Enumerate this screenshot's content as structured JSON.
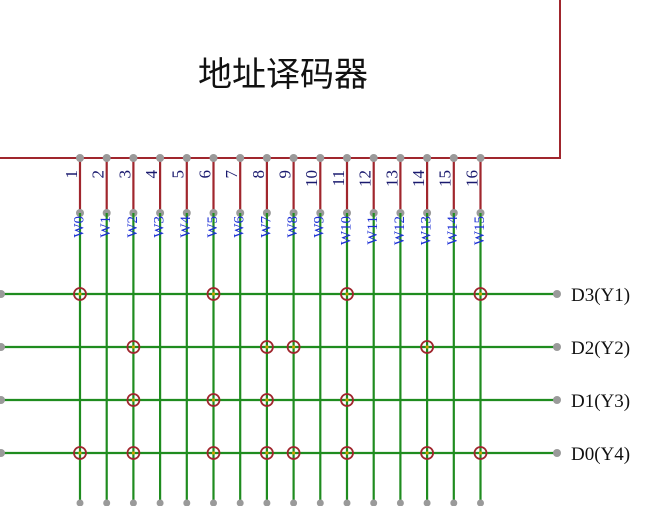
{
  "decoder": {
    "title": "地址译码器"
  },
  "pins": [
    "1",
    "2",
    "3",
    "4",
    "5",
    "6",
    "7",
    "8",
    "9",
    "10",
    "11",
    "12",
    "13",
    "14",
    "15",
    "16"
  ],
  "words": [
    "W0",
    "W1",
    "W2",
    "W3",
    "W4",
    "W5",
    "W6",
    "W7",
    "W8",
    "W9",
    "W10",
    "W11",
    "W12",
    "W13",
    "W14",
    "W15"
  ],
  "bits": [
    {
      "label": "D3(Y1)",
      "cells": [
        0,
        5,
        10,
        15
      ]
    },
    {
      "label": "D2(Y2)",
      "cells": [
        2,
        7,
        8,
        13
      ]
    },
    {
      "label": "D1(Y3)",
      "cells": [
        2,
        5,
        7,
        10
      ]
    },
    {
      "label": "D0(Y4)",
      "cells": [
        0,
        2,
        5,
        7,
        8,
        10,
        13,
        15
      ]
    }
  ],
  "colors": {
    "pin": "#a0262d",
    "grid": "#1f8c1f",
    "word_text": "#1c2fd6",
    "node": "#9a9a9a"
  }
}
